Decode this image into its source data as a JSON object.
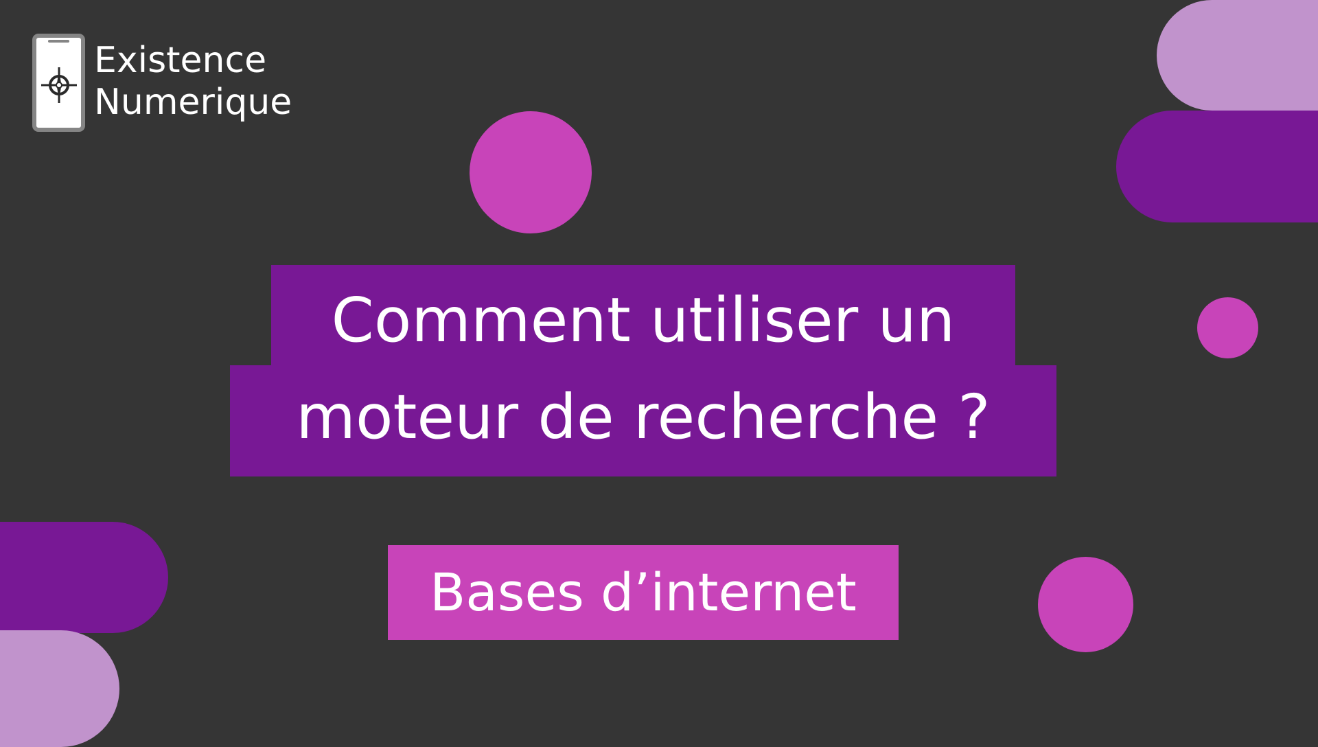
{
  "logo": {
    "line_1": "Existence",
    "line_2": "Numerique",
    "icon": "compass-icon"
  },
  "title": {
    "line_1": "Comment utiliser un",
    "line_2": "moteur de recherche ?"
  },
  "subtitle": "Bases d’internet",
  "colors": {
    "background": "#353535",
    "purple_dark": "#781895",
    "magenta": "#c844b9",
    "lavender": "#c193cc",
    "text": "#ffffff"
  }
}
